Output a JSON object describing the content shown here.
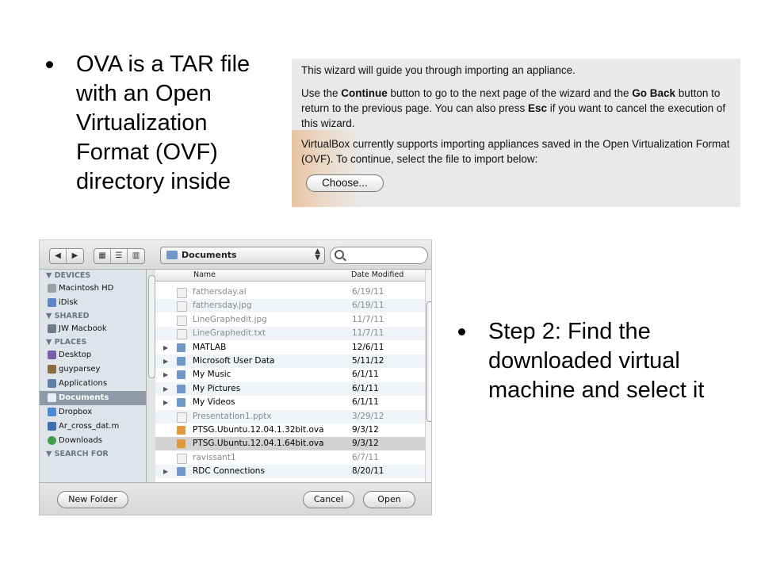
{
  "slide": {
    "bullet1": "OVA is a TAR file with an Open Virtualization Format (OVF) directory inside",
    "bullet2": "Step 2: Find the downloaded virtual machine and select it"
  },
  "wizard": {
    "line1": "This wizard will guide you through importing an appliance.",
    "line2_a": "Use the ",
    "line2_continue": "Continue",
    "line2_b": " button to go to the next page of the wizard and the ",
    "line2_goback": "Go Back",
    "line2_c": " button to return to the previous page. You can also press ",
    "line2_esc": "Esc",
    "line2_d": " if you want to cancel the execution of this wizard.",
    "line3": "VirtualBox currently supports importing appliances saved in the Open Virtualization Format (OVF). To continue, select the file to import below:",
    "choose_button": "Choose..."
  },
  "dialog": {
    "toolbar": {
      "back": "◀",
      "forward": "▶",
      "view_icons": "▦",
      "view_list": "☰",
      "view_columns": "▥",
      "location": "Documents",
      "location_arrows": "▲▼",
      "search_placeholder": ""
    },
    "sidebar": {
      "devices_header": "▼ DEVICES",
      "devices": [
        "Macintosh HD",
        "iDisk"
      ],
      "shared_header": "▼ SHARED",
      "shared": [
        "JW Macbook"
      ],
      "places_header": "▼ PLACES",
      "places": [
        "Desktop",
        "guyparsey",
        "Applications",
        "Documents",
        "Dropbox",
        "Ar_cross_dat.m",
        "Downloads"
      ],
      "selected": "Documents",
      "search_header": "▼ SEARCH FOR"
    },
    "columns": {
      "name": "Name",
      "date": "Date Modified"
    },
    "files": [
      {
        "name": "fathersday.ai",
        "date": "6/19/11",
        "folder": false,
        "dim": true
      },
      {
        "name": "fathersday.jpg",
        "date": "6/19/11",
        "folder": false,
        "dim": true
      },
      {
        "name": "LineGraphedit.jpg",
        "date": "11/7/11",
        "folder": false,
        "dim": true
      },
      {
        "name": "LineGraphedit.txt",
        "date": "11/7/11",
        "folder": false,
        "dim": true
      },
      {
        "name": "MATLAB",
        "date": "12/6/11",
        "folder": true,
        "dim": false
      },
      {
        "name": "Microsoft User Data",
        "date": "5/11/12",
        "folder": true,
        "dim": false
      },
      {
        "name": "My Music",
        "date": "6/1/11",
        "folder": true,
        "dim": false
      },
      {
        "name": "My Pictures",
        "date": "6/1/11",
        "folder": true,
        "dim": false
      },
      {
        "name": "My Videos",
        "date": "6/1/11",
        "folder": true,
        "dim": false
      },
      {
        "name": "Presentation1.pptx",
        "date": "3/29/12",
        "folder": false,
        "dim": true
      },
      {
        "name": "PTSG.Ubuntu.12.04.1.32bit.ova",
        "date": "9/3/12",
        "folder": false,
        "dim": false
      },
      {
        "name": "PTSG.Ubuntu.12.04.1.64bit.ova",
        "date": "9/3/12",
        "folder": false,
        "dim": false,
        "selected": true
      },
      {
        "name": "ravissant1",
        "date": "6/7/11",
        "folder": false,
        "dim": true
      },
      {
        "name": "RDC Connections",
        "date": "8/20/11",
        "folder": true,
        "dim": false
      }
    ],
    "buttons": {
      "new_folder": "New Folder",
      "cancel": "Cancel",
      "open": "Open"
    }
  },
  "colors": {
    "folder": "#6f98c9",
    "selection": "#d2d2d2",
    "sidebar_selection": "#8e9aa8",
    "ova_icon": "#e09a3c"
  }
}
